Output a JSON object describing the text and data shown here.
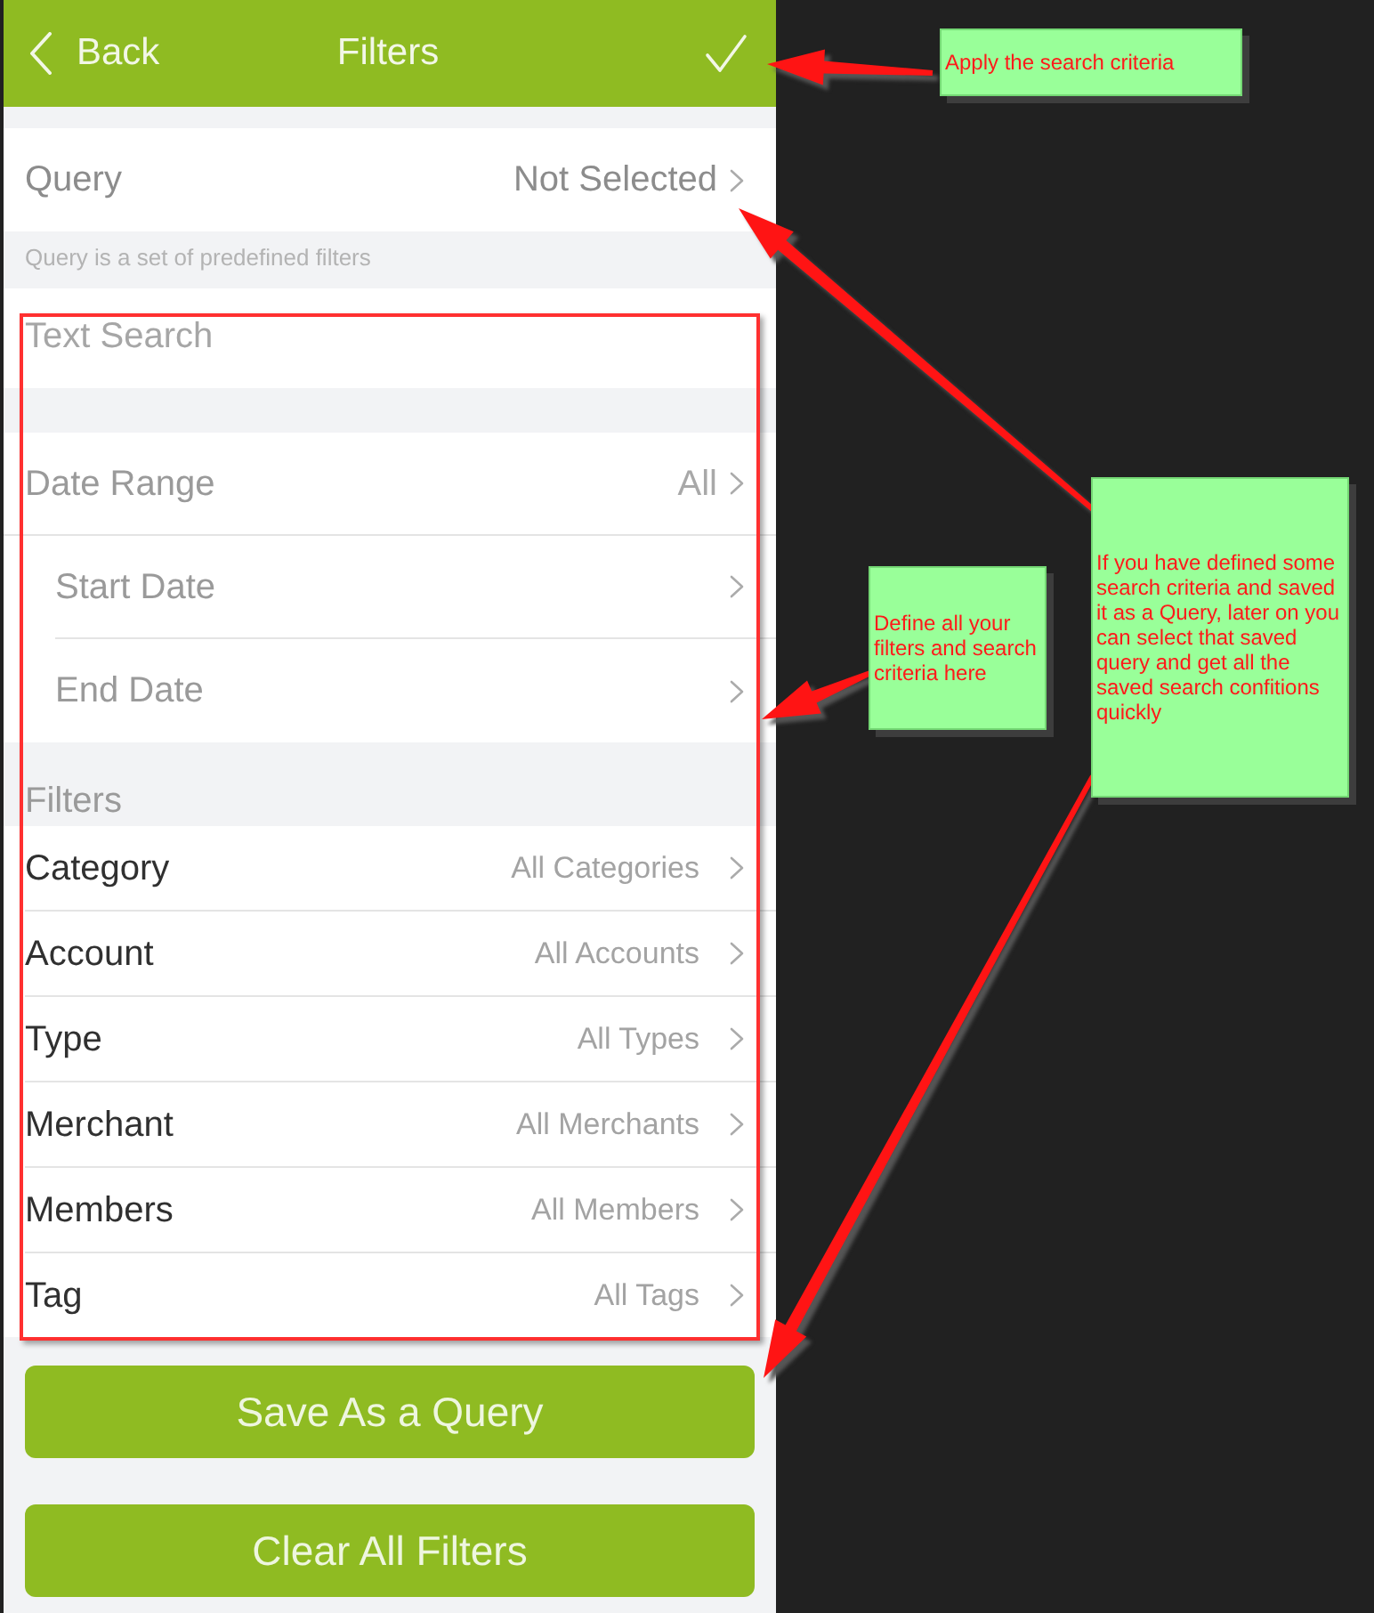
{
  "nav_bar": {
    "back": "Back",
    "title": "Filters"
  },
  "query": {
    "label": "Query",
    "value": "Not Selected",
    "hint": "Query is a set of predefined filters"
  },
  "text_search": {
    "placeholder": "Text Search"
  },
  "date_range": {
    "label": "Date Range",
    "value": "All",
    "children": [
      {
        "label": "Start Date"
      },
      {
        "label": "End Date"
      }
    ]
  },
  "filters": {
    "heading": "Filters",
    "rows": [
      {
        "label": "Category",
        "value": "All Categories"
      },
      {
        "label": "Account",
        "value": "All Accounts"
      },
      {
        "label": "Type",
        "value": "All Types"
      },
      {
        "label": "Merchant",
        "value": "All Merchants"
      },
      {
        "label": "Members",
        "value": "All Members"
      },
      {
        "label": "Tag",
        "value": "All Tags"
      }
    ]
  },
  "buttons": [
    {
      "label": "Save As a Query"
    },
    {
      "label": "Clear All Filters"
    }
  ],
  "annotations": [
    {
      "text": "Apply the search criteria"
    },
    {
      "text": "Define all your filters and search criteria here"
    },
    {
      "text": "If you have defined some search criteria and saved it as a Query, later on you can select that saved query and get all the saved search confitions quickly"
    }
  ]
}
